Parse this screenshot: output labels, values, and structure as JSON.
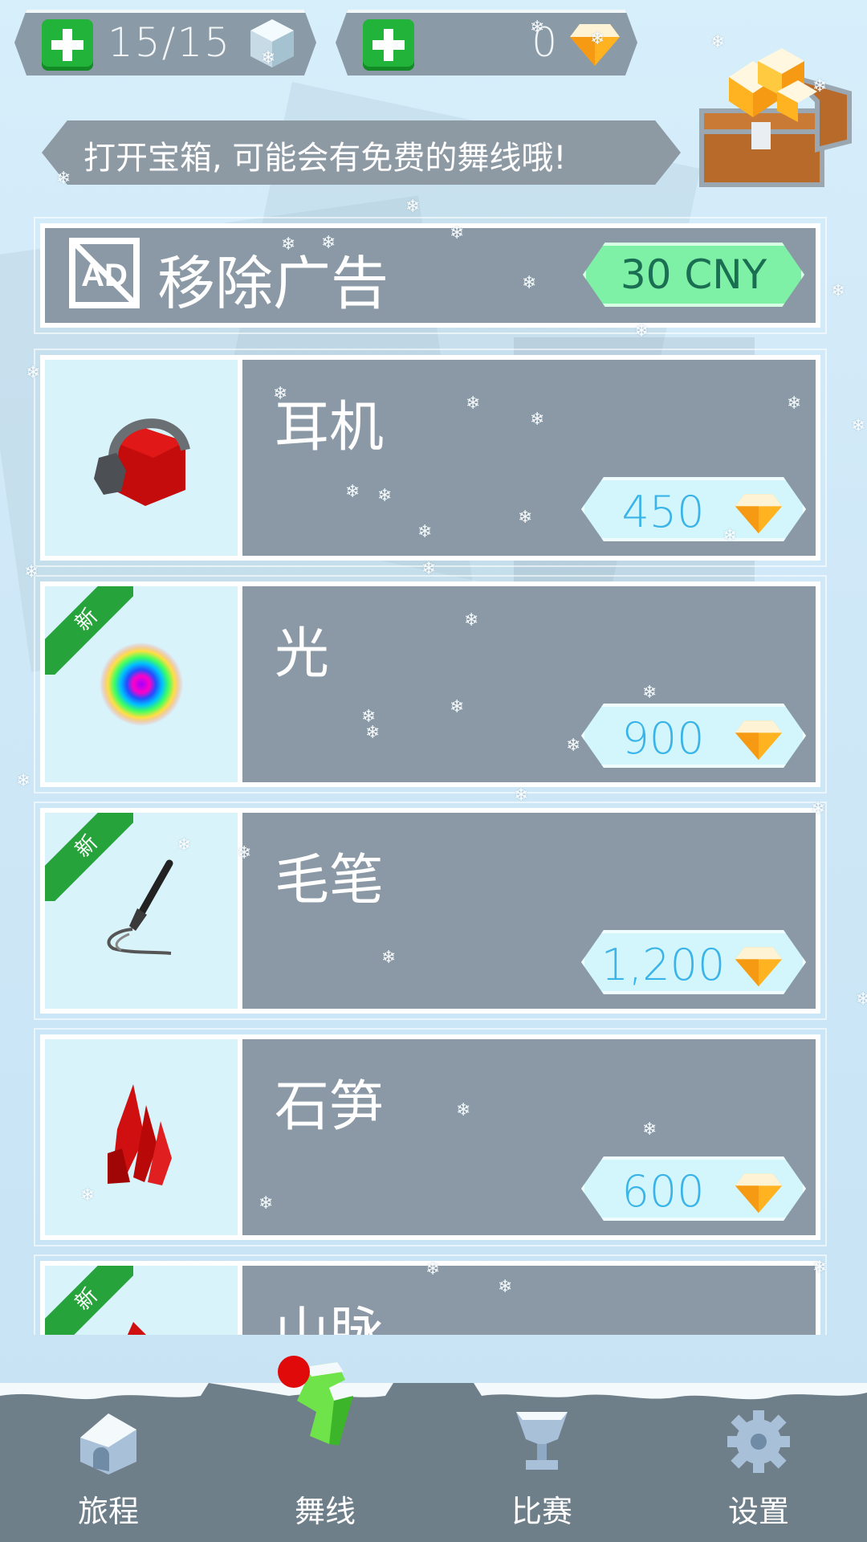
{
  "counters": {
    "energy": {
      "value": "15/15",
      "plus_icon": "plus-icon",
      "icon": "ice-cube-icon"
    },
    "gems": {
      "value": "0",
      "plus_icon": "plus-icon",
      "icon": "gem-icon"
    }
  },
  "tip": {
    "text": "打开宝箱, 可能会有免费的舞线哦!",
    "icon": "treasure-chest-icon"
  },
  "remove_ads": {
    "title": "移除广告",
    "price": "30 CNY",
    "icon": "no-ads-icon"
  },
  "items": [
    {
      "name": "耳机",
      "price": "450",
      "new": false,
      "icon": "headphones-cube-icon"
    },
    {
      "name": "光",
      "price": "900",
      "new": true,
      "new_label": "新",
      "icon": "rainbow-light-icon"
    },
    {
      "name": "毛笔",
      "price": "1,200",
      "new": true,
      "new_label": "新",
      "icon": "brush-icon"
    },
    {
      "name": "石笋",
      "price": "600",
      "new": false,
      "icon": "red-crystal-icon"
    },
    {
      "name": "山脉",
      "new": true,
      "new_label": "新",
      "icon": "mountain-icon"
    }
  ],
  "nav": [
    {
      "label": "旅程",
      "icon": "house-icon"
    },
    {
      "label": "舞线",
      "icon": "dancing-line-icon",
      "active": true
    },
    {
      "label": "比赛",
      "icon": "trophy-icon"
    },
    {
      "label": "设置",
      "icon": "gear-icon"
    }
  ],
  "colors": {
    "card": "#8a99a5",
    "green_price": "#7ff1a7",
    "price_text": "#3ab4e8",
    "ribbon": "#26a43b",
    "nav": "#6f7f8a"
  }
}
